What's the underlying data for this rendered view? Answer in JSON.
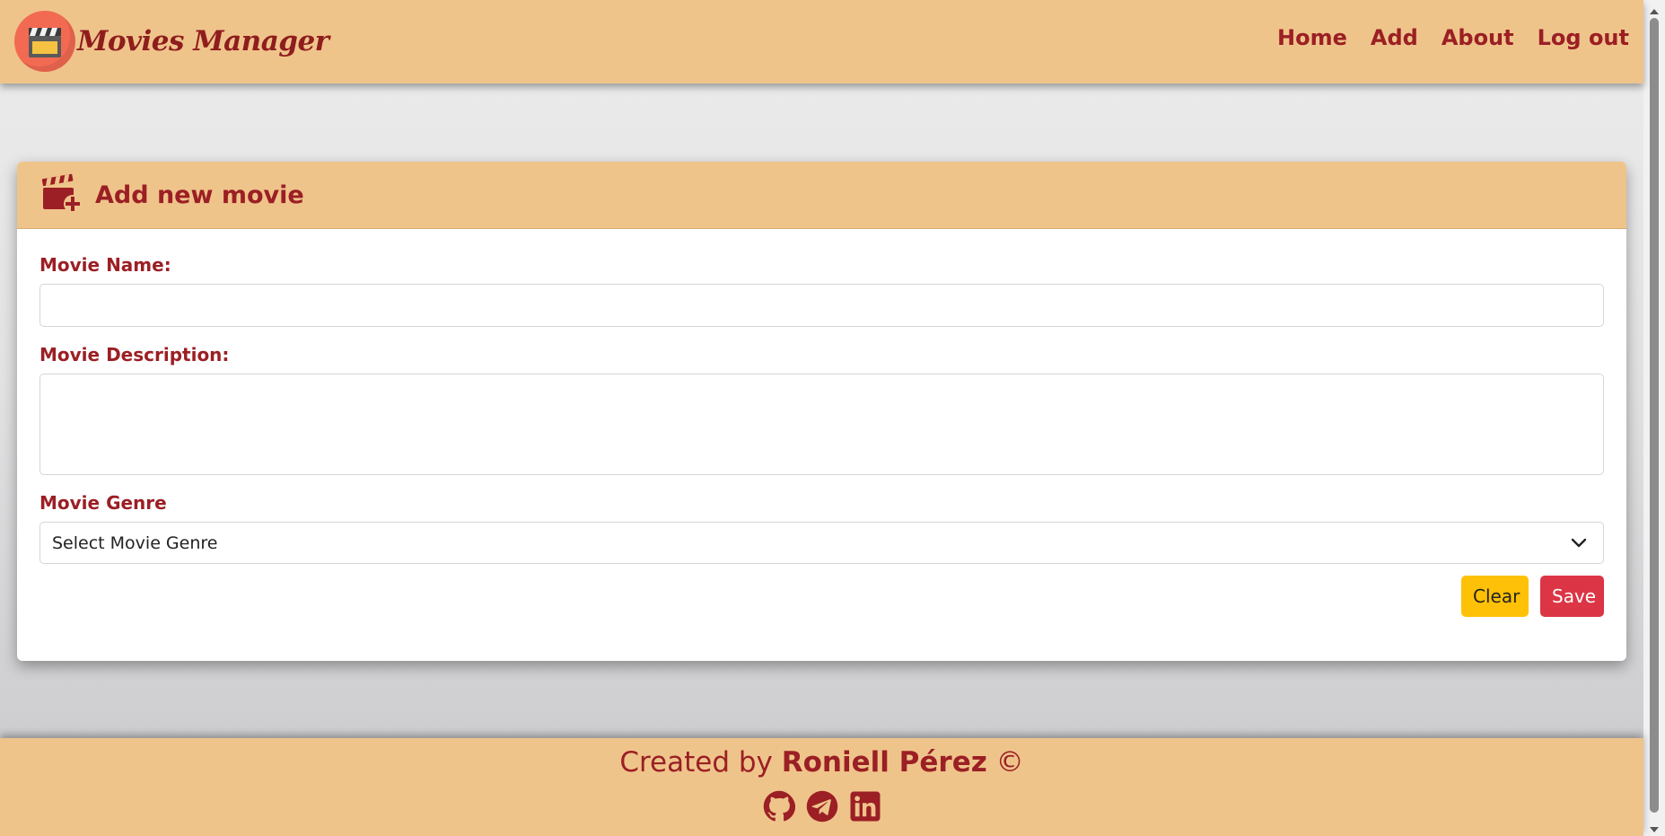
{
  "header": {
    "brand": "Movies Manager",
    "nav": [
      {
        "label": "Home"
      },
      {
        "label": "Add"
      },
      {
        "label": "About"
      },
      {
        "label": "Log out"
      }
    ]
  },
  "card": {
    "title": "Add new movie",
    "fields": {
      "name_label": "Movie Name:",
      "name_value": "",
      "description_label": "Movie Description:",
      "description_value": "",
      "genre_label": "Movie Genre",
      "genre_selected": "Select Movie Genre"
    },
    "buttons": {
      "clear": "Clear",
      "save": "Save"
    }
  },
  "footer": {
    "credit_prefix": "Created by",
    "author": "Roniell Pérez",
    "copyright": "©",
    "socials": [
      "github-icon",
      "telegram-icon",
      "linkedin-icon"
    ]
  },
  "colors": {
    "header_bg": "#efc48b",
    "primary_text": "#9b1f24",
    "clear_button": "#ffc107",
    "save_button": "#dc3545"
  }
}
